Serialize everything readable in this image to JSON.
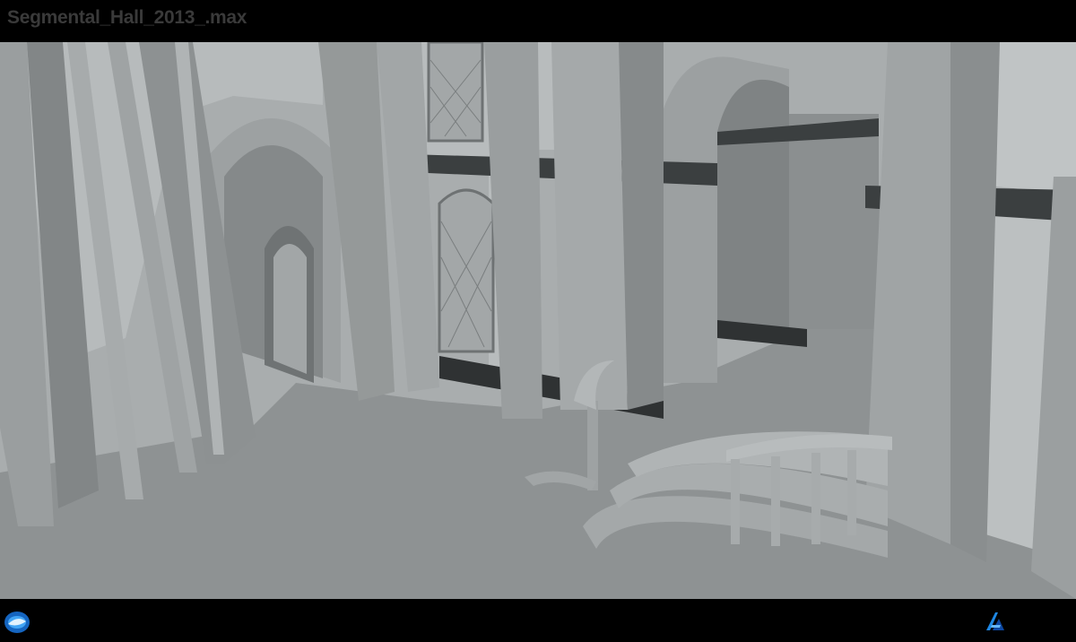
{
  "window": {
    "title": "Segmental_Hall_2013_.max"
  },
  "viewport": {
    "scene_name": "segmental-hall-render"
  },
  "footer": {
    "left_icon": "3ds-max-logo-icon",
    "right_icon": "autodesk-logo-icon"
  },
  "colors": {
    "background": "#000000",
    "title_text": "#3a3a3a",
    "scene_floor": "#8f9394",
    "scene_wall": "#b8bcbd",
    "scene_dark": "#2f3233",
    "accent_blue": "#1e88e5"
  }
}
